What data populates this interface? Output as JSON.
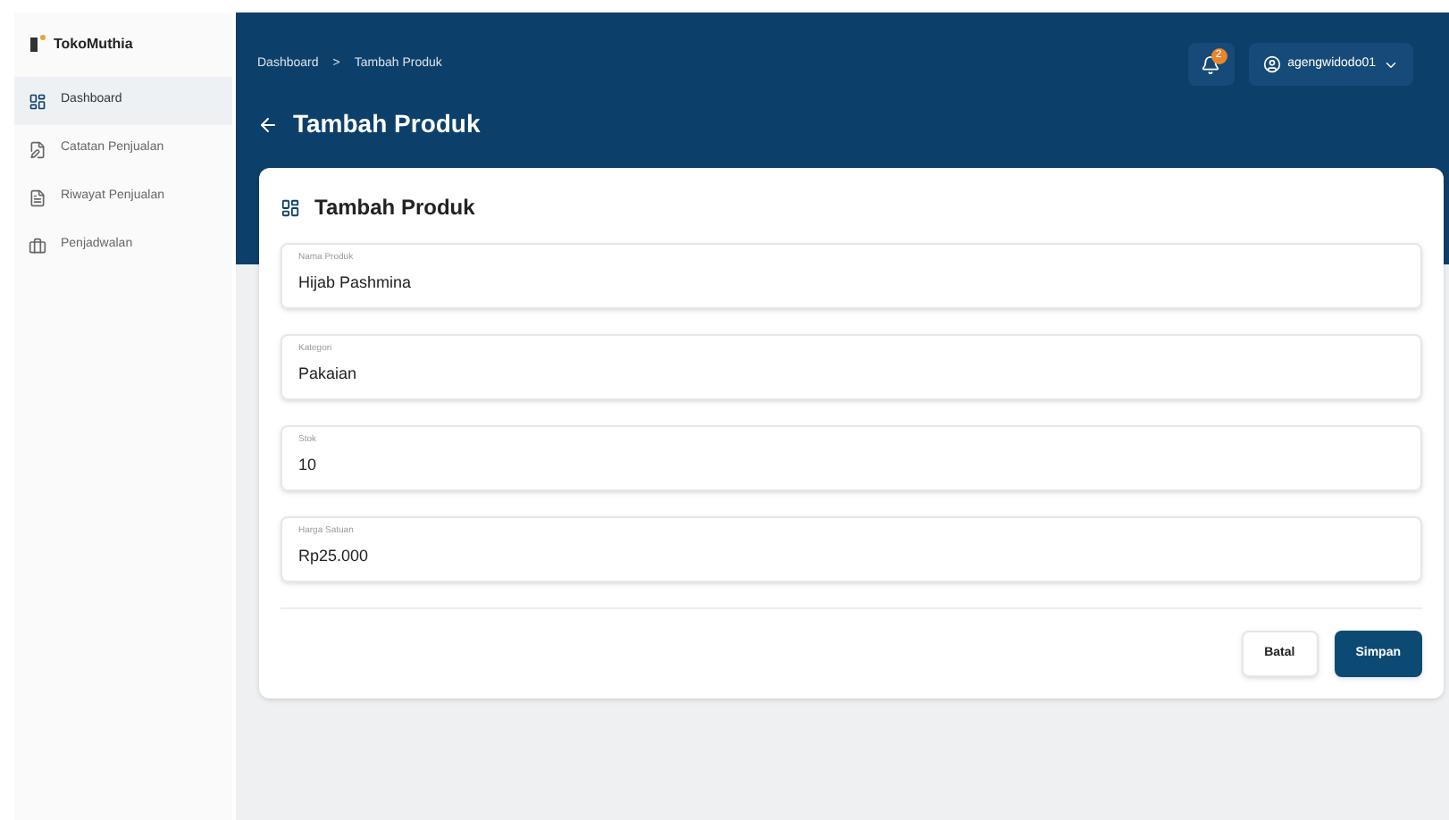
{
  "sidebar": {
    "brand": "TokoMuthia",
    "items": [
      {
        "label": "Dashboard",
        "selected": true
      },
      {
        "label": "Catatan Penjualan",
        "selected": false
      },
      {
        "label": "Riwayat Penjualan",
        "selected": false
      },
      {
        "label": "Penjadwalan",
        "selected": false
      }
    ]
  },
  "header": {
    "breadcrumb": [
      "Dashboard",
      "Tambah Produk"
    ],
    "breadcrumb_separator": ">",
    "notification_count": "2",
    "user": "agengwidodo01",
    "page_title": "Tambah Produk"
  },
  "form": {
    "title": "Tambah Produk",
    "fields": [
      {
        "label": "Nama Produk",
        "value": "Hijab Pashmina"
      },
      {
        "label": "Kategori",
        "value": "Pakaian"
      },
      {
        "label": "Stok",
        "value": "10"
      },
      {
        "label": "Harga Satuan",
        "value": "Rp25.000"
      }
    ],
    "buttons": [
      {
        "label": "Batal",
        "kind": "secondary"
      },
      {
        "label": "Simpan",
        "kind": "primary"
      }
    ]
  }
}
